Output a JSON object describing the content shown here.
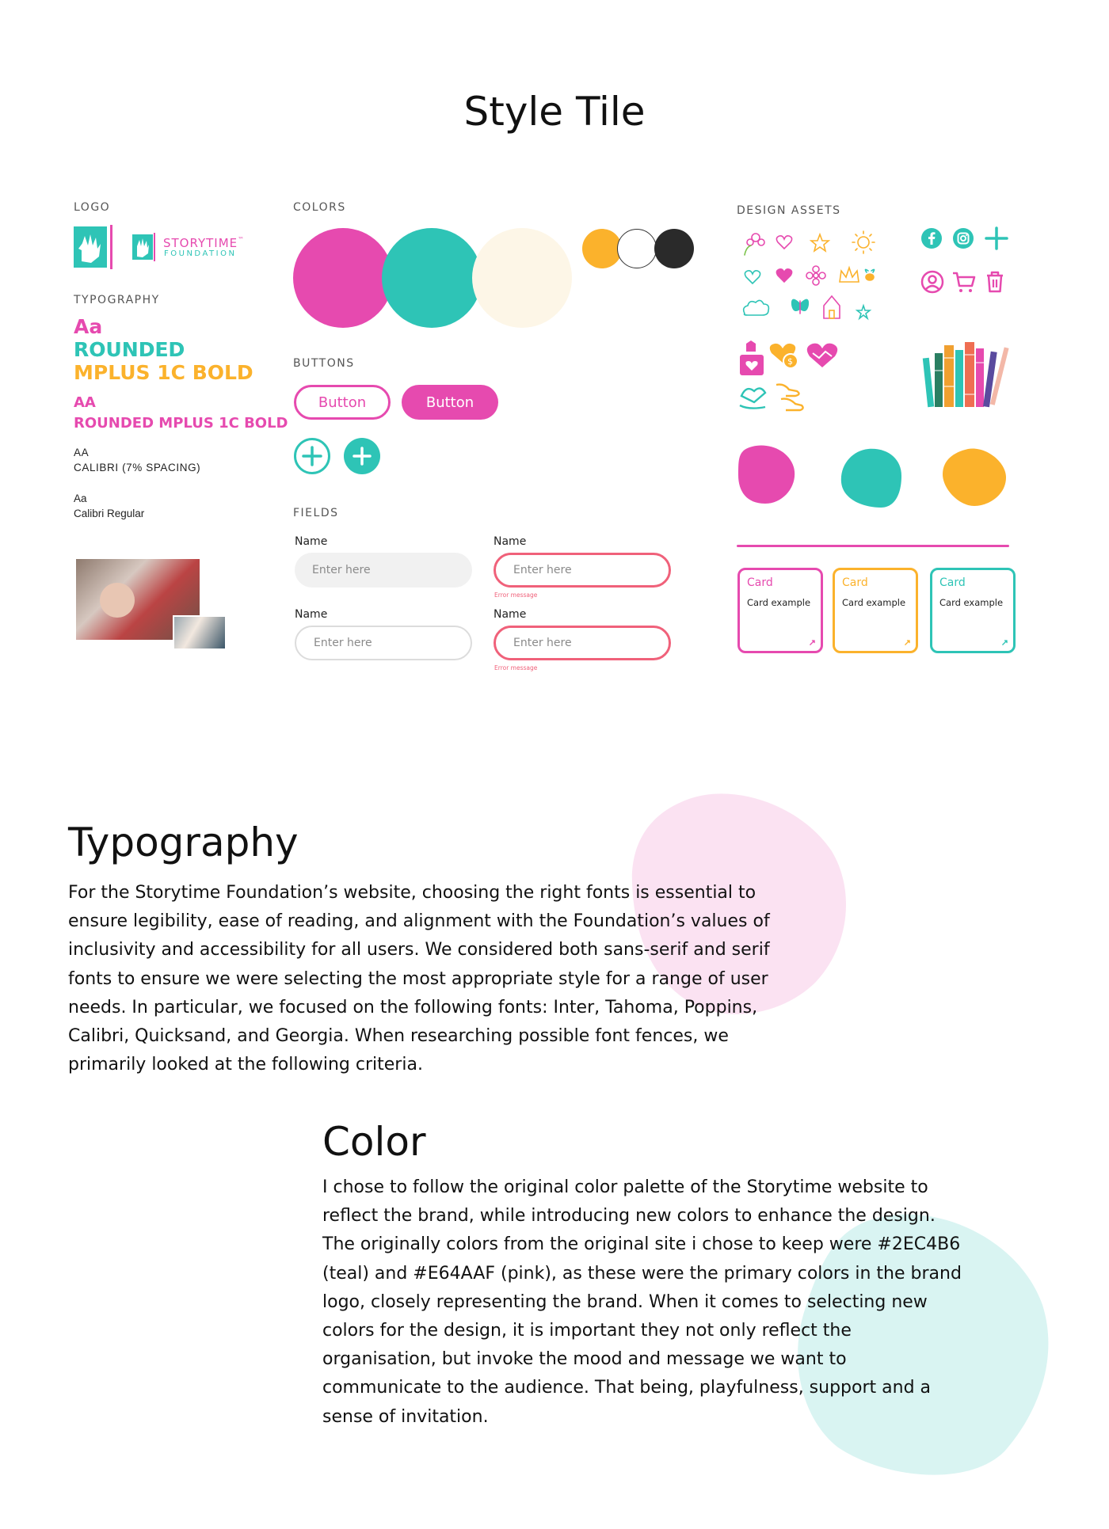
{
  "page": {
    "title": "Style Tile"
  },
  "logo": {
    "label": "LOGO",
    "wordmark_line1": "STORYTIME",
    "wordmark_tm": "™",
    "wordmark_line2": "FOUNDATION"
  },
  "typography_spec": {
    "label": "TYPOGRAPHY",
    "heading_sample": "Aa",
    "heading_font_line1": "ROUNDED",
    "heading_font_line2": "MPLUS 1C BOLD",
    "sub_sample": "AA",
    "sub_font": "ROUNDED MPLUS 1C BOLD",
    "caps_sample": "AA",
    "caps_font": "CALIBRI  (7% SPACING)",
    "body_sample": "Aa",
    "body_font": "Calibri Regular"
  },
  "colors": {
    "label": "COLORS",
    "palette": [
      "#e64aaf",
      "#2ec4b6",
      "#fdf6e7",
      "#fbb22c",
      "#ffffff",
      "#2a2a2a"
    ]
  },
  "buttons": {
    "label": "BUTTONS",
    "outline_label": "Button",
    "filled_label": "Button"
  },
  "fields": {
    "label": "FIELDS",
    "items": [
      {
        "label": "Name",
        "placeholder": "Enter here",
        "error": ""
      },
      {
        "label": "Name",
        "placeholder": "Enter here",
        "error": "Error message"
      },
      {
        "label": "Name",
        "placeholder": "Enter here",
        "error": ""
      },
      {
        "label": "Name",
        "placeholder": "Enter here",
        "error": "Error message"
      }
    ]
  },
  "design_assets": {
    "label": "DESIGN ASSETS",
    "icons": [
      "facebook-icon",
      "instagram-icon",
      "plus-icon",
      "user-icon",
      "cart-icon",
      "trash-icon"
    ],
    "blob_colors": [
      "#e64aaf",
      "#2ec4b6",
      "#fbb22c"
    ],
    "cards": [
      {
        "title": "Card",
        "text": "Card example",
        "color": "#e64aaf"
      },
      {
        "title": "Card",
        "text": "Card example",
        "color": "#fbb22c"
      },
      {
        "title": "Card",
        "text": "Card example",
        "color": "#2ec4b6"
      }
    ]
  },
  "typography_section": {
    "heading": "Typography",
    "body": "For the Storytime Foundation’s website, choosing the right fonts is essential to ensure legibility, ease of reading, and alignment with the Foundation’s values of inclusivity and accessibility for all users. We considered both sans-serif and serif fonts to ensure we were selecting the most appropriate style for a range of user needs. In particular, we focused on the following fonts: Inter, Tahoma, Poppins, Calibri, Quicksand, and Georgia. When researching possible font fences, we primarily looked at the following criteria."
  },
  "color_section": {
    "heading": "Color",
    "body": "I chose to follow the original color palette of the Storytime website to reflect the brand, while introducing new colors to enhance the design. The originally colors from the original site i chose to keep were #2EC4B6 (teal) and #E64AAF (pink), as these were the primary colors in the brand logo, closely representing the brand. When it comes to selecting new colors for the design, it is important they not only reflect the organisation, but invoke the mood and message we want to communicate to the audience. That being, playfulness, support and a sense of invitation."
  }
}
